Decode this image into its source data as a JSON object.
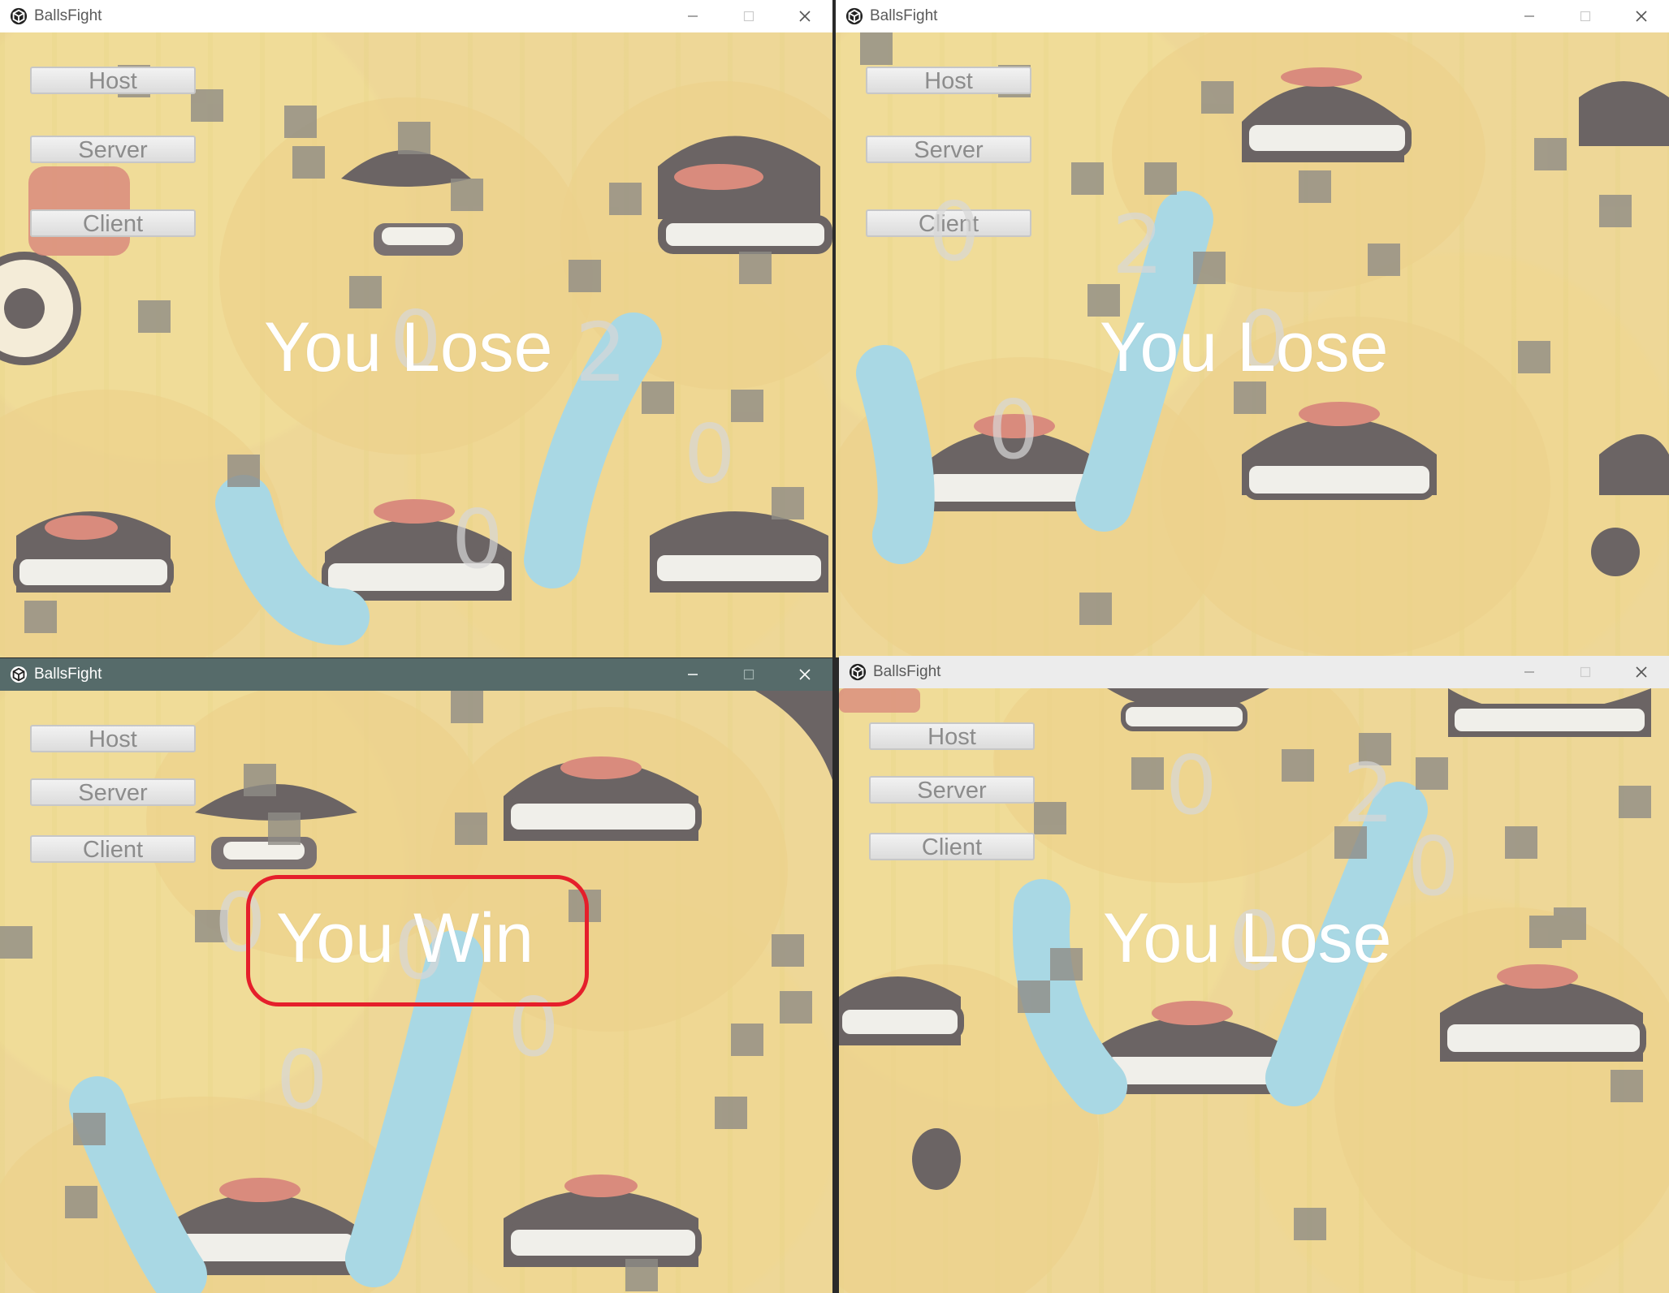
{
  "app_title": "BallsFight",
  "icons": {
    "app": "unity-icon",
    "minimize": "minimize-icon",
    "maximize": "maximize-icon",
    "close": "close-icon"
  },
  "buttons": {
    "host": "Host",
    "server": "Server",
    "client": "Client"
  },
  "windows": [
    {
      "id": "top-left",
      "active": false,
      "result": "You Lose",
      "scores": [
        "0",
        "2",
        "0",
        "0"
      ]
    },
    {
      "id": "top-right",
      "active": false,
      "result": "You Lose",
      "scores": [
        "0",
        "2",
        "0",
        "0"
      ]
    },
    {
      "id": "bottom-left",
      "active": true,
      "result": "You Win",
      "highlighted": true,
      "scores": [
        "0",
        "0",
        "0",
        "0"
      ]
    },
    {
      "id": "bottom-right",
      "active": false,
      "result": "You Lose",
      "scores": [
        "0",
        "2",
        "0",
        "0"
      ]
    }
  ],
  "colors": {
    "background_yellow": "#eed797",
    "active_titlebar": "#566b6a",
    "highlight_red": "#e51f2b",
    "ball_blue": "#a9d8e4"
  }
}
